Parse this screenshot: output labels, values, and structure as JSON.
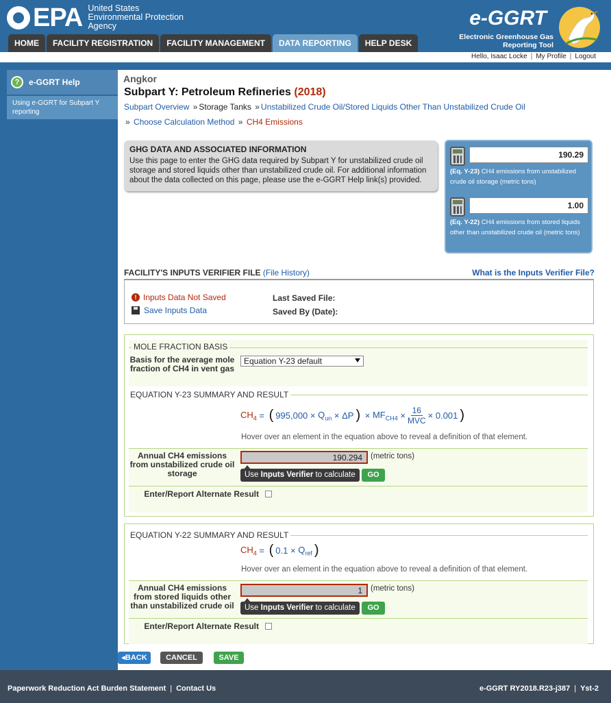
{
  "header": {
    "agency_logo": "EPA",
    "agency_name_lines": [
      "United States",
      "Environmental Protection",
      "Agency"
    ],
    "app_logo": "e-GGRT",
    "app_subtitle_lines": [
      "Electronic Greenhouse Gas",
      "Reporting Tool"
    ],
    "nav_tabs": [
      {
        "label": "HOME",
        "active": false
      },
      {
        "label": "FACILITY REGISTRATION",
        "active": false
      },
      {
        "label": "FACILITY MANAGEMENT",
        "active": false
      },
      {
        "label": "DATA REPORTING",
        "active": true
      },
      {
        "label": "HELP DESK",
        "active": false
      }
    ],
    "user_links": {
      "greeting": "Hello, Isaac Locke",
      "profile": "My Profile",
      "logout": "Logout"
    }
  },
  "sidebar": {
    "help_title": "e-GGRT Help",
    "help_link": "Using e-GGRT for Subpart Y reporting"
  },
  "main": {
    "facility": "Angkor",
    "subpart_title": "Subpart Y: Petroleum Refineries",
    "subpart_year": "(2018)",
    "breadcrumb": {
      "overview": "Subpart Overview",
      "storage": "Storage Tanks",
      "unstabilized": "Unstabilized Crude Oil/Stored Liquids Other Than Unstabilized Crude Oil",
      "method": "Choose Calculation Method",
      "current": "CH4 Emissions"
    },
    "info_box": {
      "title": "GHG DATA AND ASSOCIATED INFORMATION",
      "text": "Use this page to enter the GHG data required by Subpart Y for unstabilized crude oil storage and stored liquids other than unstabilized crude oil. For additional information about the data collected on this page, please use the e-GGRT Help link(s) provided."
    },
    "calc_panel": [
      {
        "value": "190.29",
        "eq": "(Eq. Y-23)",
        "label": " CH4 emissions from unstabilized crude oil storage (metric tons)"
      },
      {
        "value": "1.00",
        "eq": "(Eq. Y-22)",
        "label": " CH4 emissions from stored liquids other than unstabilized crude oil (metric tons)"
      }
    ],
    "verifier": {
      "title": "FACILITY'S INPUTS VERIFIER FILE",
      "history": "(File History)",
      "what_is": "What is the Inputs Verifier File?",
      "not_saved": "Inputs Data Not Saved",
      "save_link": "Save Inputs Data",
      "last_saved": "Last Saved File:",
      "saved_by": "Saved By (Date):"
    },
    "mole_fraction": {
      "title": "MOLE FRACTION BASIS",
      "label": "Basis for the average mole fraction of CH4 in vent gas",
      "selected": "Equation Y-23 default"
    },
    "eq_y23": {
      "title": "EQUATION Y-23 SUMMARY AND RESULT",
      "lhs": "CH4",
      "const": "995,000",
      "q": "Qun",
      "dp": "ΔP",
      "mf": "MFCH4",
      "num": "16",
      "den": "MVC",
      "factor": "0.001",
      "hint": "Hover over an element in the equation above to reveal a definition of that element.",
      "result_label": "Annual CH4 emissions from unstabilized crude oil storage",
      "result_value": "190.294",
      "unit": "(metric tons)",
      "verify_text_pre": "Use ",
      "verify_text_bold": "Inputs Verifier",
      "verify_text_post": " to calculate",
      "go": "GO",
      "alternate": "Enter/Report Alternate Result"
    },
    "eq_y22": {
      "title": "EQUATION Y-22 SUMMARY AND RESULT",
      "lhs": "CH4",
      "factor": "0.1",
      "q": "Qref",
      "hint": "Hover over an element in the equation above to reveal a definition of that element.",
      "result_label": "Annual CH4 emissions from stored liquids other than unstabilized crude oil",
      "result_value": "1",
      "unit": "(metric tons)",
      "verify_text_pre": "Use ",
      "verify_text_bold": "Inputs Verifier",
      "verify_text_post": " to calculate",
      "go": "GO",
      "alternate": "Enter/Report Alternate Result"
    },
    "buttons": {
      "back": "BACK",
      "cancel": "CANCEL",
      "save": "SAVE"
    }
  },
  "footer": {
    "paperwork": "Paperwork Reduction Act Burden Statement",
    "contact": "Contact Us",
    "version": "e-GGRT RY2018.R23-j387",
    "server": "Yst-2"
  }
}
